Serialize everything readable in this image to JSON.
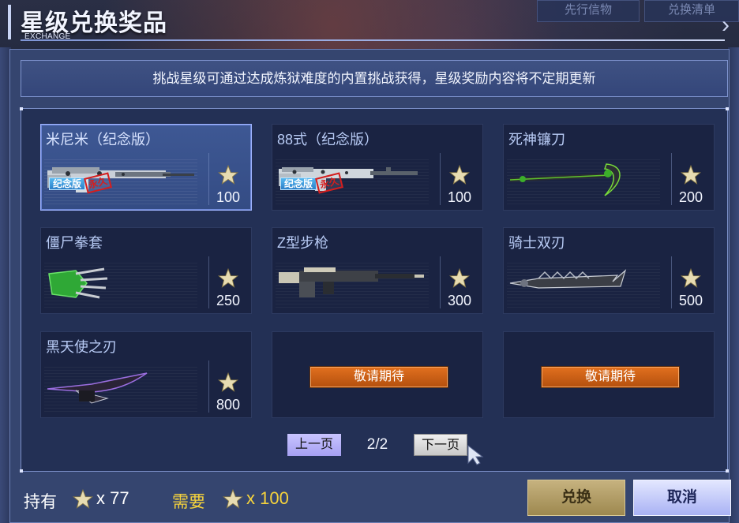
{
  "header": {
    "title": "星级兑换奖品",
    "subtitle": "EXCHANGE",
    "tabs": [
      "先行信物",
      "兑换清单"
    ]
  },
  "notice": "挑战星级可通过达成炼狱难度的内置挑战获得，星级奖励内容将不定期更新",
  "tags": {
    "memorial": "纪念版",
    "permanent": "永久"
  },
  "items": [
    {
      "name": "米尼米（纪念版）",
      "cost": "100",
      "selected": true,
      "icon": "machine-gun-icon",
      "badges": true
    },
    {
      "name": "88式（纪念版）",
      "cost": "100",
      "selected": false,
      "icon": "rifle-icon",
      "badges": true
    },
    {
      "name": "死神镰刀",
      "cost": "200",
      "selected": false,
      "icon": "scythe-icon",
      "badges": false
    },
    {
      "name": "僵尸拳套",
      "cost": "250",
      "selected": false,
      "icon": "zombie-claw-icon",
      "badges": false
    },
    {
      "name": "Z型步枪",
      "cost": "300",
      "selected": false,
      "icon": "z-rifle-icon",
      "badges": false
    },
    {
      "name": "骑士双刃",
      "cost": "500",
      "selected": false,
      "icon": "knight-blade-icon",
      "badges": false
    },
    {
      "name": "黑天使之刃",
      "cost": "800",
      "selected": false,
      "icon": "dark-angel-blade-icon",
      "badges": false
    },
    {
      "coming_soon": "敬请期待"
    },
    {
      "coming_soon": "敬请期待"
    }
  ],
  "pagination": {
    "prev": "上一页",
    "next": "下一页",
    "current": "2/2"
  },
  "footer": {
    "own_label": "持有",
    "own_count": "x 77",
    "need_label": "需要",
    "need_count": "x 100",
    "redeem": "兑换",
    "cancel": "取消"
  },
  "colors": {
    "accent_gold": "#f6d33c",
    "coming_soon_orange": "#d8661a",
    "selected_card": "#3e5894"
  }
}
